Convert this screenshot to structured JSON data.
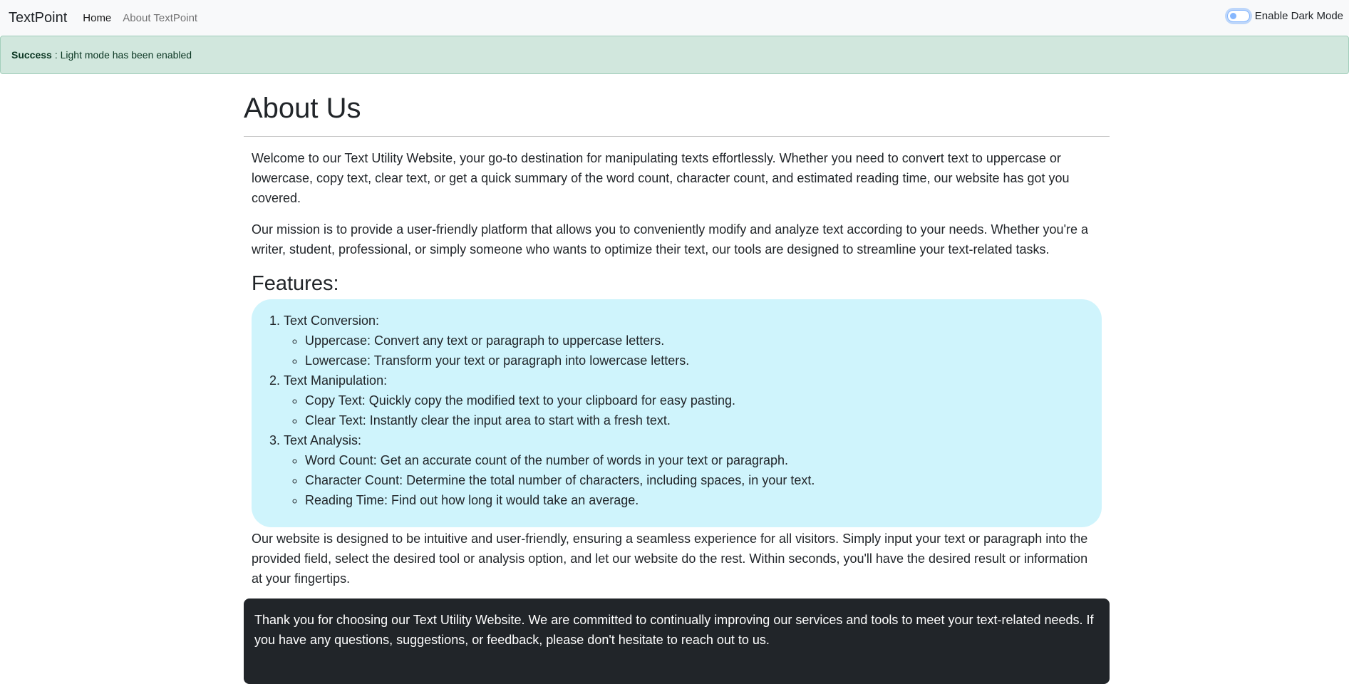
{
  "navbar": {
    "brand": "TextPoint",
    "links": [
      {
        "label": "Home"
      },
      {
        "label": "About TextPoint"
      }
    ],
    "dark_mode_label": "Enable Dark Mode"
  },
  "alert": {
    "type": "Success",
    "message": "Light mode has been enabled"
  },
  "main": {
    "title": "About Us",
    "intro_paragraphs": [
      "Welcome to our Text Utility Website, your go-to destination for manipulating texts effortlessly. Whether you need to convert text to uppercase or lowercase, copy text, clear text, or get a quick summary of the word count, character count, and estimated reading time, our website has got you covered.",
      "Our mission is to provide a user-friendly platform that allows you to conveniently modify and analyze text according to your needs. Whether you're a writer, student, professional, or simply someone who wants to optimize their text, our tools are designed to streamline your text-related tasks."
    ],
    "features_title": "Features:",
    "features": [
      {
        "label": "Text Conversion:",
        "items": [
          "Uppercase: Convert any text or paragraph to uppercase letters.",
          "Lowercase: Transform your text or paragraph into lowercase letters."
        ]
      },
      {
        "label": "Text Manipulation:",
        "items": [
          "Copy Text: Quickly copy the modified text to your clipboard for easy pasting.",
          "Clear Text: Instantly clear the input area to start with a fresh text."
        ]
      },
      {
        "label": "Text Analysis:",
        "items": [
          "Word Count: Get an accurate count of the number of words in your text or paragraph.",
          "Character Count: Determine the total number of characters, including spaces, in your text.",
          "Reading Time: Find out how long it would take an average."
        ]
      }
    ],
    "closing_paragraph": "Our website is designed to be intuitive and user-friendly, ensuring a seamless experience for all visitors. Simply input your text or paragraph into the provided field, select the desired tool or analysis option, and let our website do the rest. Within seconds, you'll have the desired result or information at your fingertips.",
    "thanks_text": "Thank you for choosing our Text Utility Website. We are committed to continually improving our services and tools to meet your text-related needs. If you have any questions, suggestions, or feedback, please don't hesitate to reach out to us."
  },
  "colors": {
    "navbar_bg": "#f8f9fa",
    "alert_bg": "#d1e7dd",
    "features_bg": "#cff4fc",
    "thanks_bg": "#212529"
  }
}
